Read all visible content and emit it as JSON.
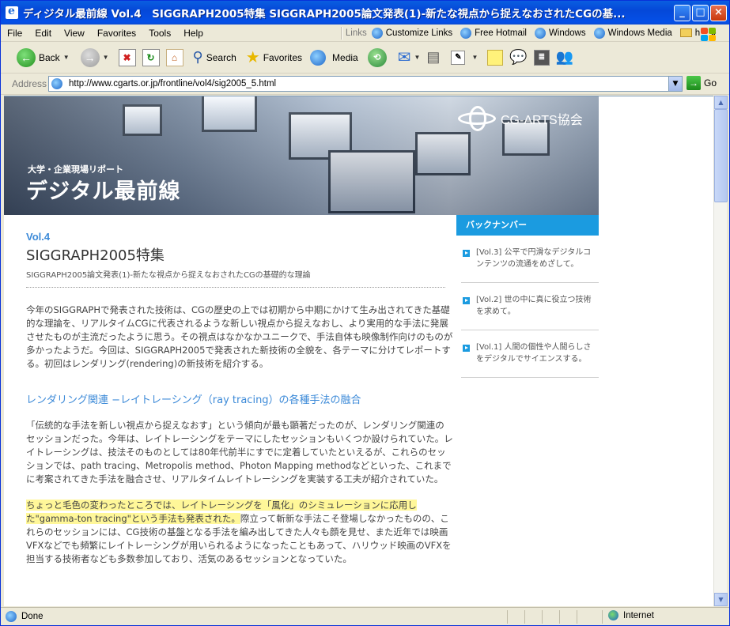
{
  "window": {
    "title": "ディジタル最前線 Vol.4　SIGGRAPH2005特集 SIGGRAPH2005論文発表(1)-新たな視点から捉えなおされたCGの基..."
  },
  "menu": {
    "items": [
      "File",
      "Edit",
      "View",
      "Favorites",
      "Tools",
      "Help"
    ],
    "links_label": "Links",
    "links": [
      "Customize Links",
      "Free Hotmail",
      "Windows",
      "Windows Media",
      "h"
    ]
  },
  "toolbar": {
    "back": "Back",
    "search": "Search",
    "favorites": "Favorites",
    "media": "Media"
  },
  "address": {
    "label": "Address",
    "url": "http://www.cgarts.or.jp/frontline/vol4/sig2005_5.html",
    "go": "Go"
  },
  "banner": {
    "subtitle": "大学・企業現場リポート",
    "title": "デジタル最前線",
    "logo_text": "CG-ARTS協会"
  },
  "article": {
    "vol": "Vol.4",
    "heading": "SIGGRAPH2005特集",
    "subheading": "SIGGRAPH2005論文発表(1)-新たな視点から捉えなおされたCGの基礎的な理論",
    "intro": "今年のSIGGRAPHで発表された技術は、CGの歴史の上では初期から中期にかけて生み出されてきた基礎的な理論を、リアルタイムCGに代表されるような新しい視点から捉えなおし、より実用的な手法に発展させたものが主流だったように思う。その視点はなかなかユニークで、手法自体も映像制作向けのものが多かったようだ。今回は、SIGGRAPH2005で発表された新技術の全貌を、各テーマに分けてレポートする。初回はレンダリング(rendering)の新技術を紹介する。",
    "section_title": "レンダリング関連 −レイトレーシング（ray tracing）の各種手法の融合",
    "para1": "「伝統的な手法を新しい視点から捉えなおす」という傾向が最も顕著だったのが、レンダリング関連のセッションだった。今年は、レイトレーシングをテーマにしたセッションもいくつか設けられていた。レイトレーシングは、技法そのものとしては80年代前半にすでに定着していたといえるが、これらのセッションでは、path tracing、Metropolis method、Photon Mapping methodなどといった、これまでに考案されてきた手法を融合させ、リアルタイムレイトレーシングを実装する工夫が紹介されていた。",
    "para2_highlight": "ちょっと毛色の変わったところでは、レイトレーシングを「風化」のシミュレーションに応用した\"gamma-ton tracing\"という手法も発表された。",
    "para2_rest": "際立って斬新な手法こそ登場しなかったものの、これらのセッションには、CG技術の基盤となる手法を編み出してきた人々も顔を見せ、また近年では映画VFXなどでも頻繁にレイトレーシングが用いられるようになったこともあって、ハリウッド映画のVFXを担当する技術者なども多数参加しており、活気のあるセッションとなっていた。"
  },
  "backnumber": {
    "heading": "バックナンバー",
    "items": [
      "[Vol.3] 公平で円滑なデジタルコンテンツの流通をめざして。",
      "[Vol.2] 世の中に真に役立つ技術を求めて。",
      "[Vol.1] 人間の個性や人間らしさをデジタルでサイエンスする。"
    ]
  },
  "status": {
    "text": "Done",
    "zone": "Internet"
  },
  "colors": {
    "accent": "#1b9be0",
    "title_blue": "#3c8ad8",
    "highlight": "#fff799"
  }
}
